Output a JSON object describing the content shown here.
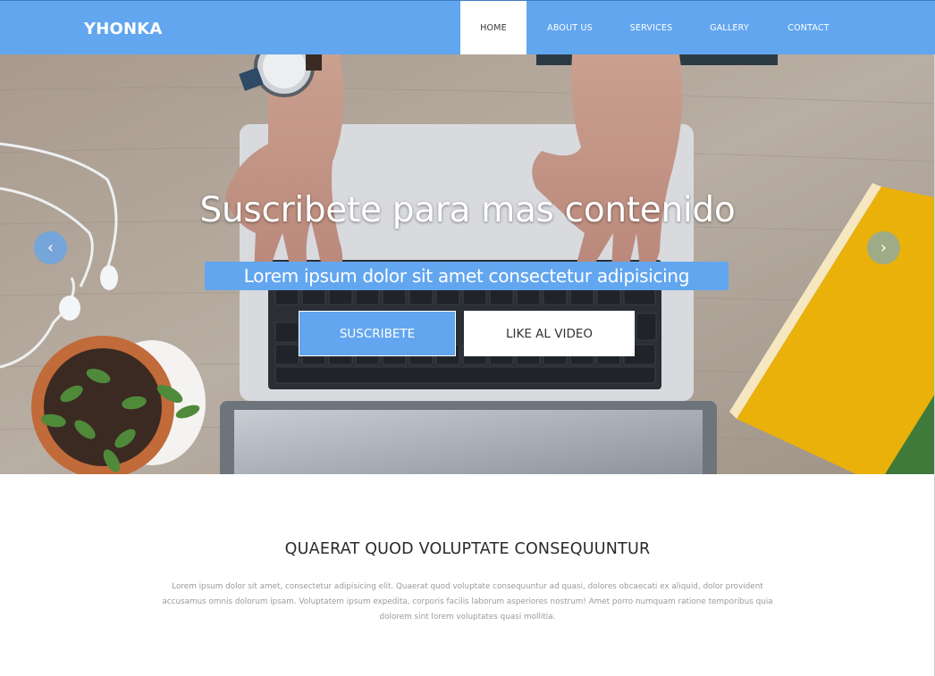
{
  "navbar": {
    "brand": "YHONKA",
    "links": [
      {
        "label": "HOME",
        "active": true
      },
      {
        "label": "ABOUT US",
        "active": false
      },
      {
        "label": "SERVICES",
        "active": false
      },
      {
        "label": "GALLERY",
        "active": false
      },
      {
        "label": "CONTACT",
        "active": false
      }
    ]
  },
  "hero": {
    "title": "Suscribete para mas contenido",
    "subtitle": "Lorem ipsum dolor sit amet consectetur adipisicing",
    "primary_button": "SUSCRIBETE",
    "secondary_button": "LIKE AL VIDEO",
    "prev_arrow_icon": "chevron-left-icon",
    "next_arrow_icon": "chevron-right-icon",
    "prev_arrow_glyph": "‹",
    "next_arrow_glyph": "›"
  },
  "section": {
    "title": "QUAERAT QUOD VOLUPTATE CONSEQUUNTUR",
    "text": "Lorem ipsum dolor sit amet, consectetur adipisicing elit. Quaerat quod voluptate consequuntur ad quasi, dolores obcaecati ex aliquid, dolor provident accusamus omnis dolorum ipsam. Voluptatem ipsum expedita, corporis facilis laborum asperiores nostrum! Amet porro numquam ratione temporibus quia dolorem sint lorem voluptates quasi mollitia."
  },
  "colors": {
    "accent": "#62a6ef",
    "white": "#ffffff",
    "text_dark": "#2a2a2a",
    "text_muted": "#9a9a9a"
  }
}
